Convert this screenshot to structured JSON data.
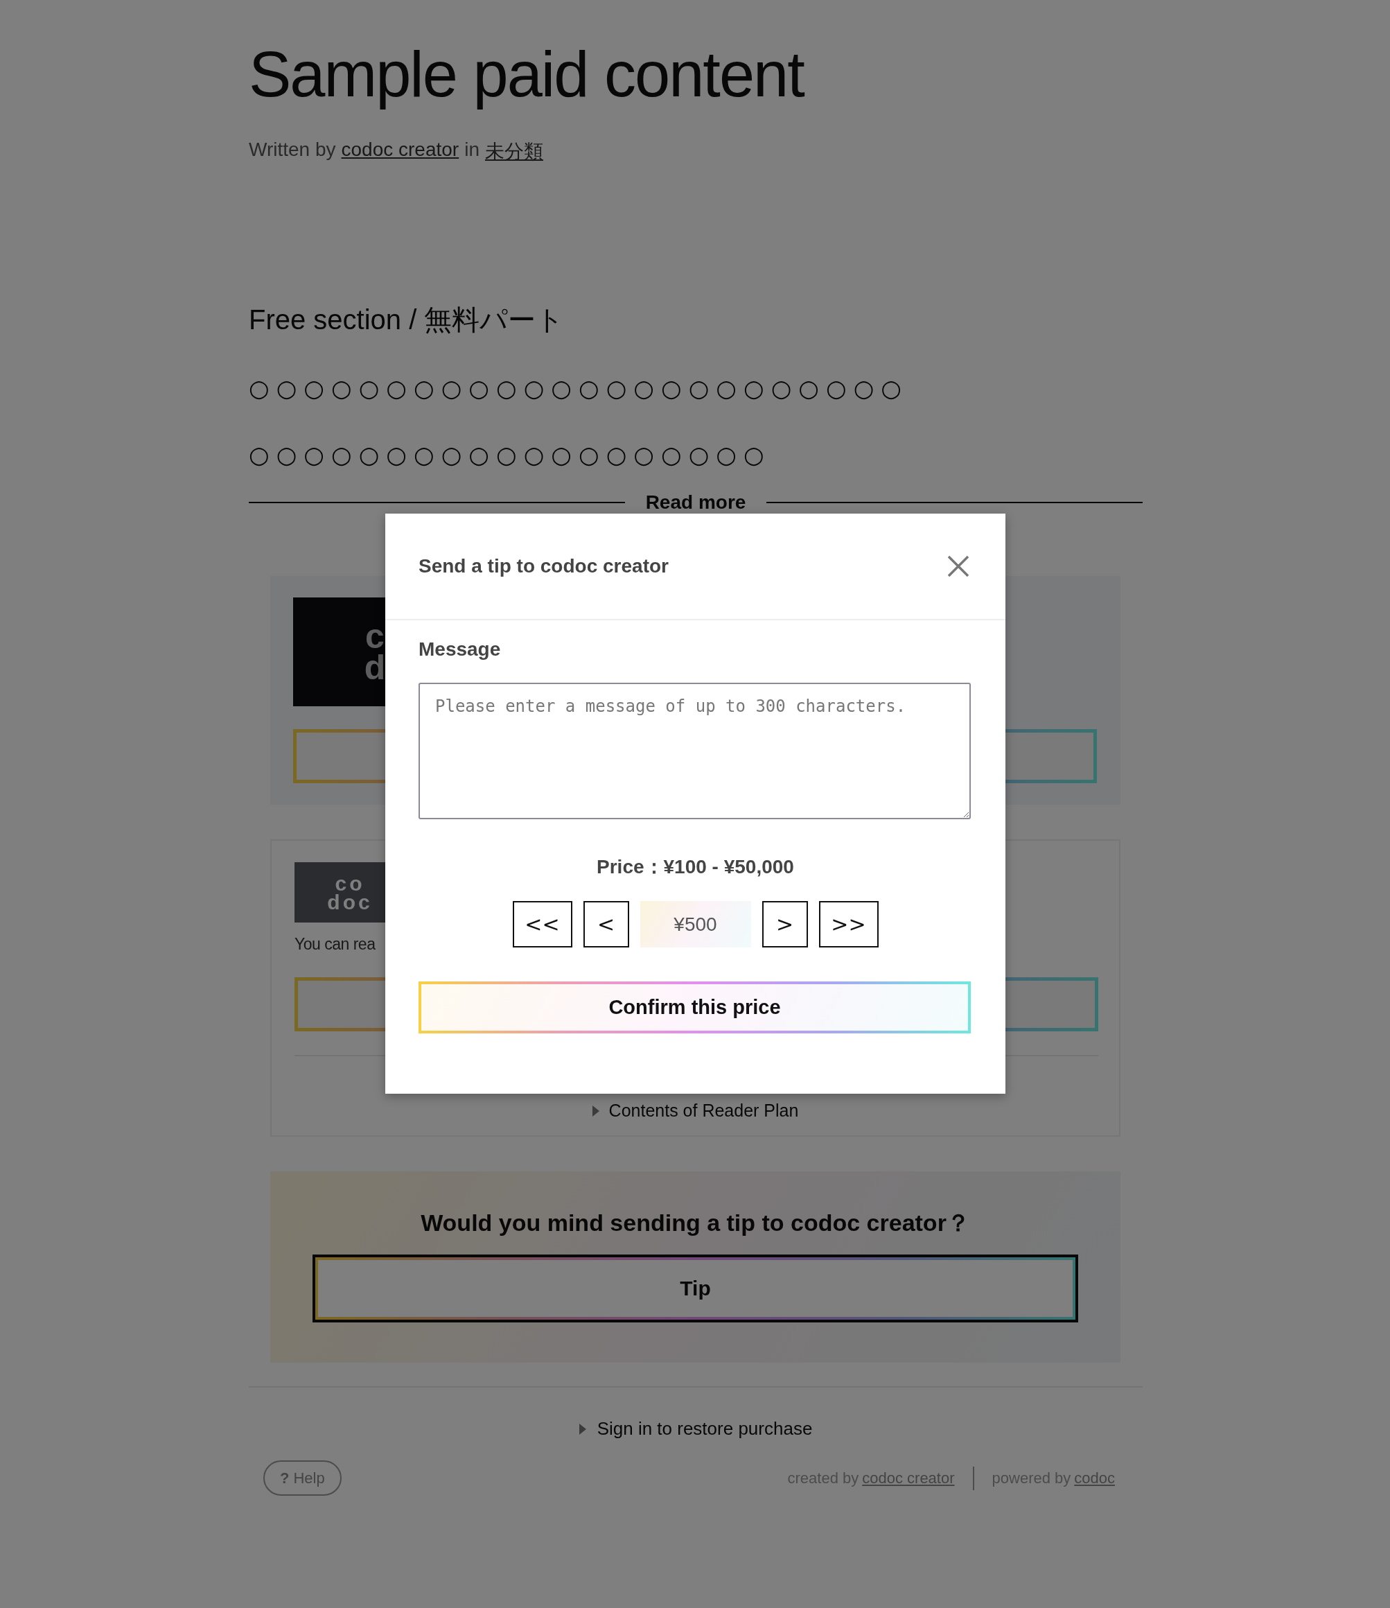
{
  "article": {
    "title": "Sample paid content",
    "byline": {
      "prefix": "Written by",
      "author": "codoc creator",
      "joiner": "in",
      "category": "未分類"
    },
    "section_heading": "Free section / 無料パート",
    "paragraphs": [
      "○○○○○○○○○○○○○○○○○○○○○○○○",
      "○○○○○○○○○○○○○○○○○○○"
    ],
    "read_more": "Read more"
  },
  "plans": [
    {
      "kind": "dark",
      "logo": [
        "c",
        "d"
      ]
    },
    {
      "kind": "light",
      "logo": [
        "co",
        "doc"
      ],
      "note": "You can rea",
      "details": "Contents of Reader Plan"
    }
  ],
  "tip_card": {
    "heading": "Would you mind sending a tip to codoc creator？",
    "button": "Tip"
  },
  "restore": "Sign in to restore purchase",
  "footer": {
    "help_icon": "?",
    "help": "Help",
    "created_prefix": "created by",
    "creator": "codoc creator",
    "powered_prefix": "powered by",
    "powered": "codoc"
  },
  "modal": {
    "title": "Send a tip to codoc creator",
    "message_label": "Message",
    "placeholder": "Please enter a message of up to 300 characters.",
    "price_range": "Price：¥100 - ¥50,000",
    "steppers_down": [
      "<<",
      "<"
    ],
    "amount": "¥500",
    "steppers_up": [
      ">",
      ">>"
    ],
    "confirm": "Confirm this price"
  }
}
